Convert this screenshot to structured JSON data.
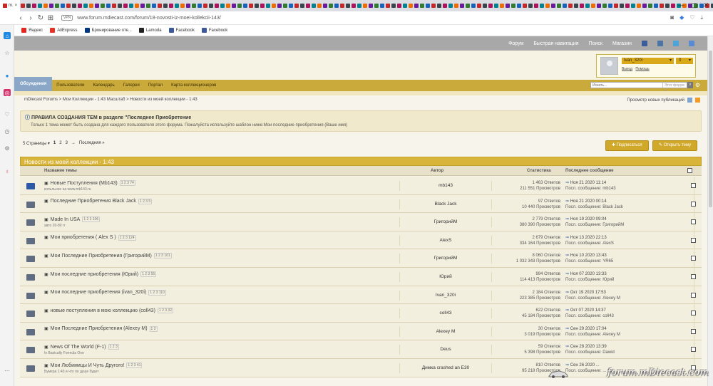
{
  "browser": {
    "address": "www.forum.mdiecast.com/forum/18-novosti-iz-moei-kollekcii-143/",
    "vpn": "VPN",
    "active_tab": "m.",
    "bookmarks": [
      {
        "label": "Яндекс",
        "color": "#e52620"
      },
      {
        "label": "AliExpress",
        "color": "#e43225"
      },
      {
        "label": "Бронирование оте...",
        "color": "#003580"
      },
      {
        "label": "Lamoda",
        "color": "#222222"
      },
      {
        "label": "Facebook",
        "color": "#3b5998"
      },
      {
        "label": "Facebook",
        "color": "#3b5998"
      }
    ]
  },
  "topnav": {
    "items": [
      "Форум",
      "Быстрая навигация",
      "Поиск",
      "Магазин"
    ]
  },
  "user": {
    "name": "Ivan_320i",
    "count": "0",
    "logout": "Выход",
    "help": "Помощь"
  },
  "mainnav": {
    "tabs": [
      "Обсуждения",
      "Пользователи",
      "Календарь",
      "Галерея",
      "Портал",
      "Карта коллекционеров"
    ],
    "search_placeholder": "Искать...",
    "search_scope": "Этот форум"
  },
  "breadcrumb": "mDiecast Forums > Мои Коллекции - 1:43 Масштаб > Новости из моей коллекции - 1:43",
  "new_publications": "Просмотр новых публикаций",
  "notice": {
    "title": "ПРАВИЛА СОЗДАНИЯ ТЕМ в разделе \"Последнее Приобретение",
    "text": "Только 1 тема может быть создана для каждого пользователя этого форума. Пожалуйста используйте шаблон ниже:Мои последние приобретения (Ваше имя)"
  },
  "pager": {
    "pages": "5 Страницы",
    "p1": "1",
    "p2": "2",
    "p3": "3",
    "arrow": "→",
    "last": "Последняя »"
  },
  "buttons": {
    "subscribe": "Подписаться",
    "new_topic": "Открыть тему"
  },
  "section": {
    "title": "Новости из моей коллекции - 1:43",
    "col_topic": "Название темы",
    "col_author": "Автор",
    "col_stats": "Статистика",
    "col_last": "Последнее сообщение"
  },
  "topics": [
    {
      "title": "Новые Поступления (Mb143)",
      "pages": "1 2 3 74",
      "sub": "копьльное на www.mb143.ru",
      "author": "mb143",
      "replies": "1 463 Ответов",
      "views": "211 551 Просмотров",
      "date": "Ноя 21 2020 11:14",
      "last": "Посл. сообщение: mb143",
      "new": true
    },
    {
      "title": "Последние Приобретения Black Jack",
      "pages": "1 2 3 5",
      "sub": "",
      "author": "Black Jack",
      "replies": "97 Ответов",
      "views": "10 440 Просмотров",
      "date": "Ноя 21 2020 00:14",
      "last": "Посл. сообщение: Black Jack",
      "new": false
    },
    {
      "title": "Made In USA",
      "pages": "1 2 3 106",
      "sub": "авто 20-80 гг",
      "author": "ГригорийМ",
      "replies": "2 779 Ответов",
      "views": "380 390 Просмотров",
      "date": "Ноя 19 2020 09:04",
      "last": "Посл. сообщение: ГригорийМ",
      "new": false
    },
    {
      "title": "Мои приобретения ( Alex S )",
      "pages": "1 2 3 124",
      "sub": "",
      "author": "AlexS",
      "replies": "2 679 Ответов",
      "views": "334 164 Просмотров",
      "date": "Ноя 13 2020 22:13",
      "last": "Посл. сообщение: AlexS",
      "new": false
    },
    {
      "title": "Мои Последние Приобретения (ГригорийМ)",
      "pages": "1 2 3 101",
      "sub": "",
      "author": "ГригорийМ",
      "replies": "8 060 Ответов",
      "views": "1 032 343 Просмотров",
      "date": "Ноя 10 2020 13:43",
      "last": "Посл. сообщение: YR65",
      "new": false
    },
    {
      "title": "Мои последние приобретения (Юрий)",
      "pages": "1 2 3 55",
      "sub": "",
      "author": "Юрий",
      "replies": "994 Ответов",
      "views": "114 413 Просмотров",
      "date": "Ноя 07 2020 13:33",
      "last": "Посл. сообщение: Юрий",
      "new": false
    },
    {
      "title": "Мои последние приобретения (ivan_320i)",
      "pages": "1 2 3 110",
      "sub": "",
      "author": "Ivan_320i",
      "replies": "2 184 Ответов",
      "views": "223 385 Просмотров",
      "date": "Окт 19 2020 17:53",
      "last": "Посл. сообщение: Alexey M",
      "new": false
    },
    {
      "title": "новые поступления в мою коллекцию (coll43)",
      "pages": "1 2 3 32",
      "sub": "",
      "author": "coll43",
      "replies": "622 Ответов",
      "views": "45 184 Просмотров",
      "date": "Окт 07 2020 14:37",
      "last": "Посл. сообщение: coll43",
      "new": false
    },
    {
      "title": "Мои Последние Приобретения (Alexey M)",
      "pages": "1 2",
      "sub": "",
      "author": "Alexey M",
      "replies": "30 Ответов",
      "views": "3 019 Просмотров",
      "date": "Сен 29 2020 17:04",
      "last": "Посл. сообщение: Alexey M",
      "new": false
    },
    {
      "title": "News Of The World (F-1)",
      "pages": "1 2 3",
      "sub": "In Basically Formula One",
      "author": "Deus",
      "replies": "59 Ответов",
      "views": "5 398 Просмотров",
      "date": "Сен 28 2020 13:39",
      "last": "Посл. сообщение: Dawid",
      "new": false
    },
    {
      "title": "Мои Любимицы И Чуть Другого!",
      "pages": "1 2 3 41",
      "sub": "Бумера 1:43 и что по душе будет",
      "author": "Димка crashed an E30",
      "replies": "810 Ответов",
      "views": "95 218 Просмотров",
      "date": "Сен 26 2020 ...",
      "last": "Посл. сообщение: ...",
      "new": false
    }
  ],
  "watermark": "forum.mDiecast.com"
}
